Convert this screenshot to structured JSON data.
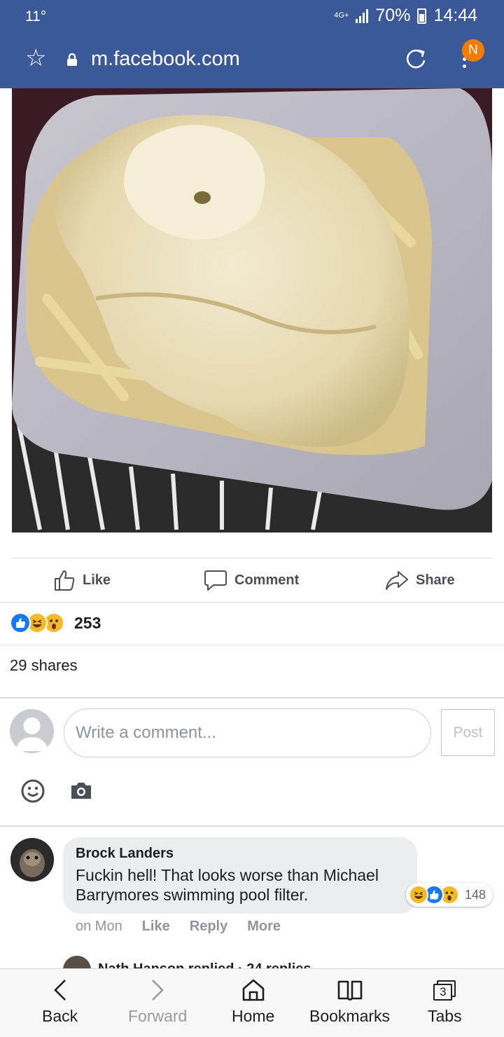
{
  "status_bar": {
    "temperature": "11°",
    "network": "4G+",
    "battery": "70%",
    "time": "14:44"
  },
  "address_bar": {
    "url": "m.facebook.com",
    "notification_badge": "N"
  },
  "post": {
    "photo_alt": "Chips covered in white sauce in a polystyrene tray",
    "actions": {
      "like": "Like",
      "comment": "Comment",
      "share": "Share"
    },
    "reaction_count": "253",
    "shares": "29 shares"
  },
  "composer": {
    "placeholder": "Write a comment...",
    "post_label": "Post"
  },
  "comment": {
    "author": "Brock Landers",
    "text": "Fuckin hell! That looks worse than Michael Barrymores swimming pool filter.",
    "reaction_count": "148",
    "time": "on Mon",
    "like": "Like",
    "reply": "Reply",
    "more": "More"
  },
  "reply_preview": {
    "text": "Nath Hanson replied · 24 replies"
  },
  "bottom_nav": {
    "back": "Back",
    "forward": "Forward",
    "home": "Home",
    "bookmarks": "Bookmarks",
    "tabs": "Tabs",
    "tab_count": "3"
  },
  "colors": {
    "facebook_blue": "#3b5998",
    "like_blue": "#1877f2",
    "haha_yellow": "#f7b928",
    "badge_orange": "#f57c00"
  }
}
